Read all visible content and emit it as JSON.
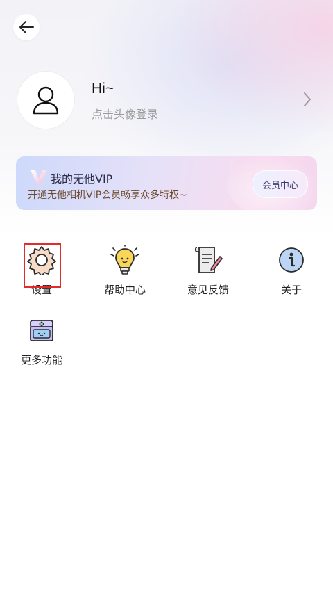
{
  "header": {
    "back_icon": "arrow-left-icon"
  },
  "profile": {
    "greeting": "Hi~",
    "login_hint": "点击头像登录",
    "avatar_icon": "user-icon",
    "chevron_icon": "chevron-right-icon"
  },
  "vip": {
    "title": "我的无他VIP",
    "subtitle": "开通无他相机VIP会员畅享众多特权~",
    "button_label": "会员中心",
    "logo_icon": "vip-v-logo-icon"
  },
  "menu": {
    "items": [
      {
        "label": "设置",
        "icon": "gear-icon"
      },
      {
        "label": "帮助中心",
        "icon": "lightbulb-icon"
      },
      {
        "label": "意见反馈",
        "icon": "feedback-scroll-icon"
      },
      {
        "label": "关于",
        "icon": "info-icon"
      },
      {
        "label": "更多功能",
        "icon": "treasure-chest-icon"
      }
    ]
  },
  "colors": {
    "highlight": "#e42a2a",
    "vip_gradient_start": "#cdd9fb",
    "vip_gradient_end": "#f4d7ee"
  }
}
